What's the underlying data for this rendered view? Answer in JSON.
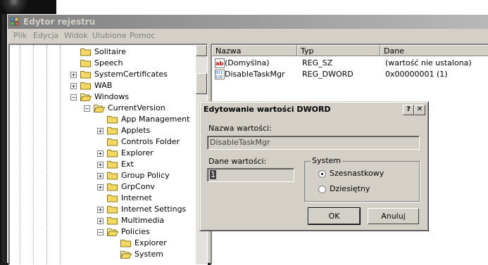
{
  "window": {
    "title": "Edytor rejestru",
    "icon": "registry-editor-icon"
  },
  "menu": [
    "Plik",
    "Edycja",
    "Widok",
    "Ulubione",
    "Pomoc"
  ],
  "tree": [
    {
      "label": "Solitaire",
      "expandable": false
    },
    {
      "label": "Speech",
      "expandable": false
    },
    {
      "label": "SystemCertificates",
      "expandable": true
    },
    {
      "label": "WAB",
      "expandable": true
    },
    {
      "label": "Windows",
      "expandable": true,
      "expanded": true
    },
    {
      "label": "CurrentVersion",
      "expandable": true,
      "expanded": true
    },
    {
      "label": "App Management",
      "expandable": false
    },
    {
      "label": "Applets",
      "expandable": true
    },
    {
      "label": "Controls Folder",
      "expandable": false
    },
    {
      "label": "Explorer",
      "expandable": true
    },
    {
      "label": "Ext",
      "expandable": true
    },
    {
      "label": "Group Policy",
      "expandable": true
    },
    {
      "label": "GrpConv",
      "expandable": true
    },
    {
      "label": "Internet",
      "expandable": false
    },
    {
      "label": "Internet Settings",
      "expandable": true
    },
    {
      "label": "Multimedia",
      "expandable": true
    },
    {
      "label": "Policies",
      "expandable": true,
      "expanded": true
    },
    {
      "label": "Explorer",
      "expandable": false
    },
    {
      "label": "System",
      "expandable": false,
      "selected": true
    }
  ],
  "list": {
    "columns": [
      "Nazwa",
      "Typ",
      "Dane"
    ],
    "rows": [
      {
        "name": "(Domyślna)",
        "type": "REG_SZ",
        "data": "(wartość nie ustalona)",
        "icon": "string-value-icon"
      },
      {
        "name": "DisableTaskMgr",
        "type": "REG_DWORD",
        "data": "0x00000001 (1)",
        "icon": "binary-value-icon"
      }
    ]
  },
  "dialog": {
    "title": "Edytowanie wartości DWORD",
    "help_label": "?",
    "close_label": "✕",
    "value_name_label": "Nazwa wartości:",
    "value_name": "DisableTaskMgr",
    "value_data_label": "Dane wartości:",
    "value_data": "1",
    "base_group_label": "System",
    "base_options": [
      "Szesnastkowy",
      "Dziesiętny"
    ],
    "base_selected": "Szesnastkowy",
    "ok_label": "OK",
    "cancel_label": "Anuluj"
  }
}
